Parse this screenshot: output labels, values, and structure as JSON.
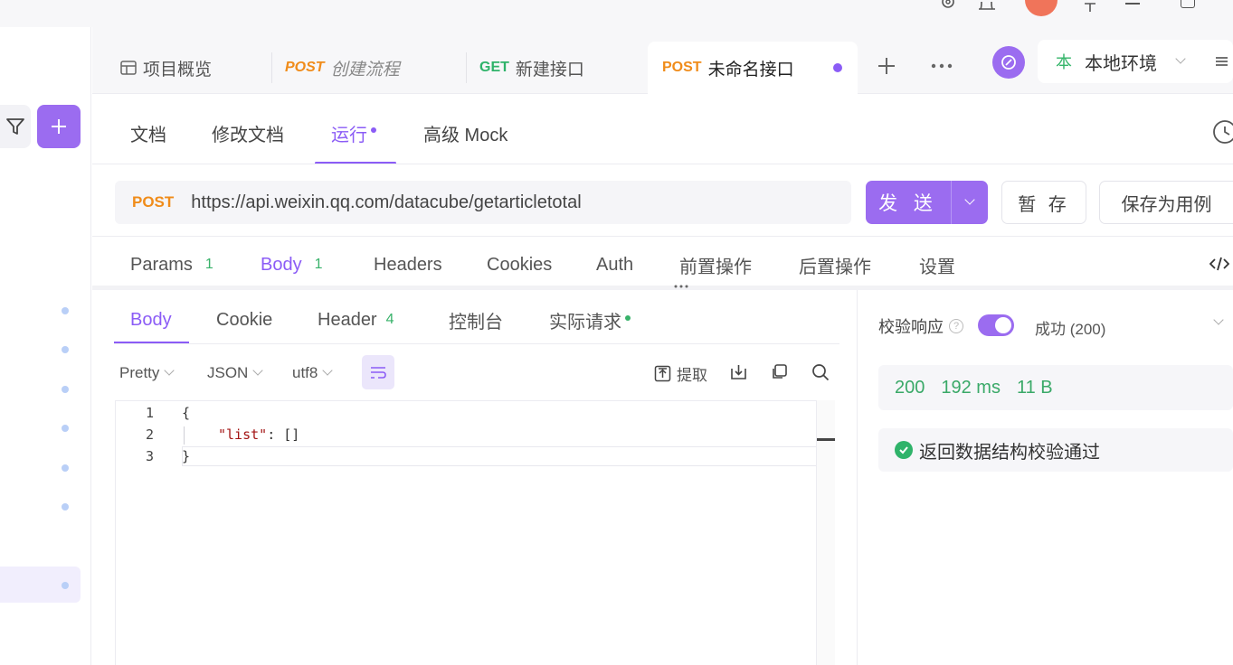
{
  "tabs": [
    {
      "method": "",
      "label": "项目概览",
      "icon": "overview-icon"
    },
    {
      "method": "POST",
      "label": "创建流程"
    },
    {
      "method": "GET",
      "label": "新建接口"
    },
    {
      "method": "POST",
      "label": "未命名接口",
      "active": true
    }
  ],
  "environment": {
    "badge": "本",
    "label": "本地环境"
  },
  "doc_tabs": [
    "文档",
    "修改文档",
    "运行",
    "高级 Mock"
  ],
  "request": {
    "method": "POST",
    "url": "https://api.weixin.qq.com/datacube/getarticletotal",
    "send_label": "发 送",
    "save_label": "暂 存",
    "save_case_label": "保存为用例"
  },
  "param_tabs": [
    {
      "label": "Params",
      "count": "1"
    },
    {
      "label": "Body",
      "count": "1"
    },
    {
      "label": "Headers",
      "count": ""
    },
    {
      "label": "Cookies",
      "count": ""
    },
    {
      "label": "Auth",
      "count": ""
    },
    {
      "label": "前置操作",
      "count": ""
    },
    {
      "label": "后置操作",
      "count": ""
    },
    {
      "label": "设置",
      "count": ""
    }
  ],
  "response_tabs": [
    {
      "label": "Body",
      "count": ""
    },
    {
      "label": "Cookie",
      "count": ""
    },
    {
      "label": "Header",
      "count": "4"
    },
    {
      "label": "控制台",
      "count": ""
    },
    {
      "label": "实际请求",
      "count": ""
    }
  ],
  "format": {
    "view": "Pretty",
    "type": "JSON",
    "encoding": "utf8",
    "extract_label": "提取"
  },
  "code": {
    "line_numbers": [
      "1",
      "2",
      "3"
    ],
    "lines": [
      "{",
      "\"list\"",
      ": []",
      "}"
    ]
  },
  "validation": {
    "label": "校验响应",
    "status_text": "成功 (200)",
    "status_code": "200",
    "time": "192 ms",
    "size": "11 B",
    "result": "返回数据结构校验通过"
  },
  "colors": {
    "accent": "#9b6cf0",
    "post": "#f08c1a",
    "get": "#2fb36a",
    "success": "#2fb36a"
  }
}
